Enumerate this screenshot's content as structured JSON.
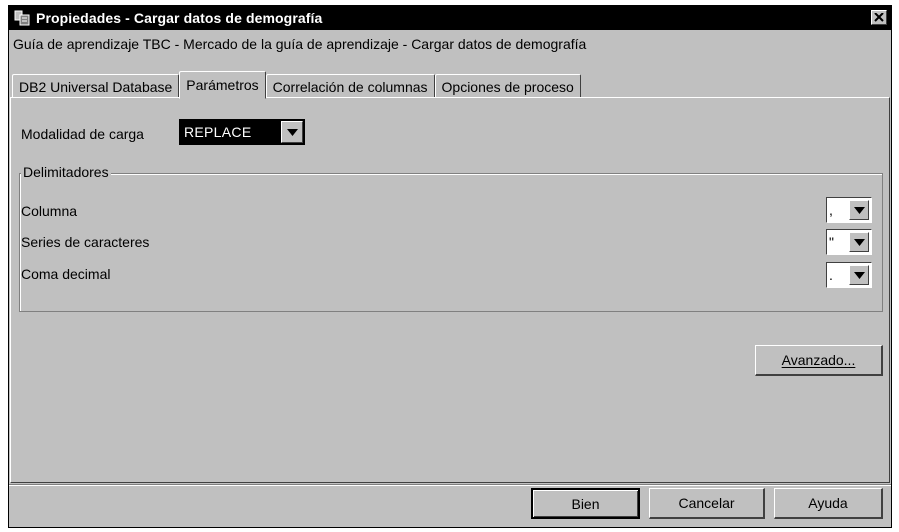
{
  "window": {
    "title": "Propiedades - Cargar datos de demografía",
    "icon": "app-properties-icon",
    "close_icon": "close-icon"
  },
  "subtitle": "Guía de aprendizaje TBC - Mercado de la guía de aprendizaje - Cargar datos de demografía",
  "tabs": [
    {
      "label": "DB2 Universal Database",
      "active": false
    },
    {
      "label": "Parámetros",
      "active": true
    },
    {
      "label": "Correlación de columnas",
      "active": false
    },
    {
      "label": "Opciones de proceso",
      "active": false
    }
  ],
  "load_mode": {
    "label": "Modalidad de carga",
    "value": "REPLACE"
  },
  "delimiters": {
    "title": "Delimitadores",
    "rows": [
      {
        "label": "Columna",
        "value": ","
      },
      {
        "label": "Series de caracteres",
        "value": "\""
      },
      {
        "label": "Coma decimal",
        "value": "."
      }
    ]
  },
  "advanced_button": "Avanzado...",
  "footer": {
    "ok": "Bien",
    "cancel": "Cancelar",
    "help": "Ayuda"
  }
}
